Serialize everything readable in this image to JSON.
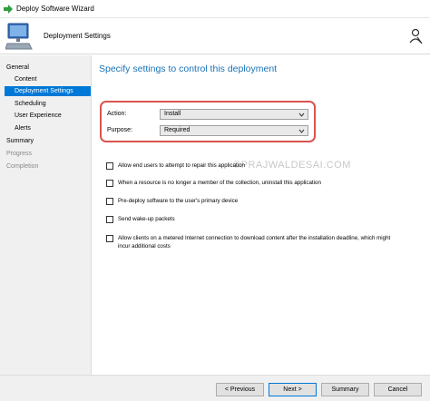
{
  "window": {
    "title": "Deploy Software Wizard"
  },
  "header": {
    "heading": "Deployment Settings"
  },
  "sidebar": {
    "items": [
      {
        "label": "General"
      },
      {
        "label": "Content"
      },
      {
        "label": "Deployment Settings"
      },
      {
        "label": "Scheduling"
      },
      {
        "label": "User Experience"
      },
      {
        "label": "Alerts"
      },
      {
        "label": "Summary"
      },
      {
        "label": "Progress"
      },
      {
        "label": "Completion"
      }
    ]
  },
  "main": {
    "title": "Specify settings to control this deployment",
    "action": {
      "label": "Action:",
      "value": "Install"
    },
    "purpose": {
      "label": "Purpose:",
      "value": "Required"
    },
    "watermark": "©PRAJWALDESAI.COM",
    "options": [
      {
        "label": "Allow end users to attempt to repair this application"
      },
      {
        "label": "When a resource is no longer a member of the collection, uninstall this application"
      },
      {
        "label": "Pre-deploy software to the user's primary device"
      },
      {
        "label": "Send wake-up packets"
      },
      {
        "label": "Allow clients on a metered Internet connection to download content after the installation deadline, which might",
        "label2": "incur additional costs"
      }
    ]
  },
  "footer": {
    "previous": "< Previous",
    "next": "Next >",
    "summary": "Summary",
    "cancel": "Cancel"
  },
  "colors": {
    "accent": "#0078d7",
    "highlight_border": "#d9534f",
    "title_blue": "#1a73b8"
  }
}
